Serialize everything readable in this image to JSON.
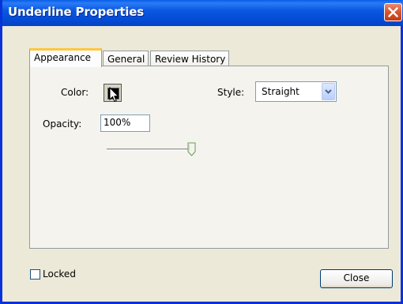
{
  "window": {
    "title": "Underline Properties",
    "close_icon": "close-icon"
  },
  "tabs": [
    {
      "label": "Appearance",
      "active": true
    },
    {
      "label": "General",
      "active": false
    },
    {
      "label": "Review History",
      "active": false
    }
  ],
  "appearance": {
    "color_label": "Color:",
    "color_value": "#000000",
    "style_label": "Style:",
    "style_value": "Straight",
    "opacity_label": "Opacity:",
    "opacity_value": "100%",
    "opacity_slider_fraction": 1.0
  },
  "footer": {
    "locked_label": "Locked",
    "locked_checked": false,
    "close_label": "Close"
  },
  "colors": {
    "titlebar": "#0449d3",
    "dialog_bg": "#ece9d8",
    "tab_accent": "#ffc73c"
  }
}
